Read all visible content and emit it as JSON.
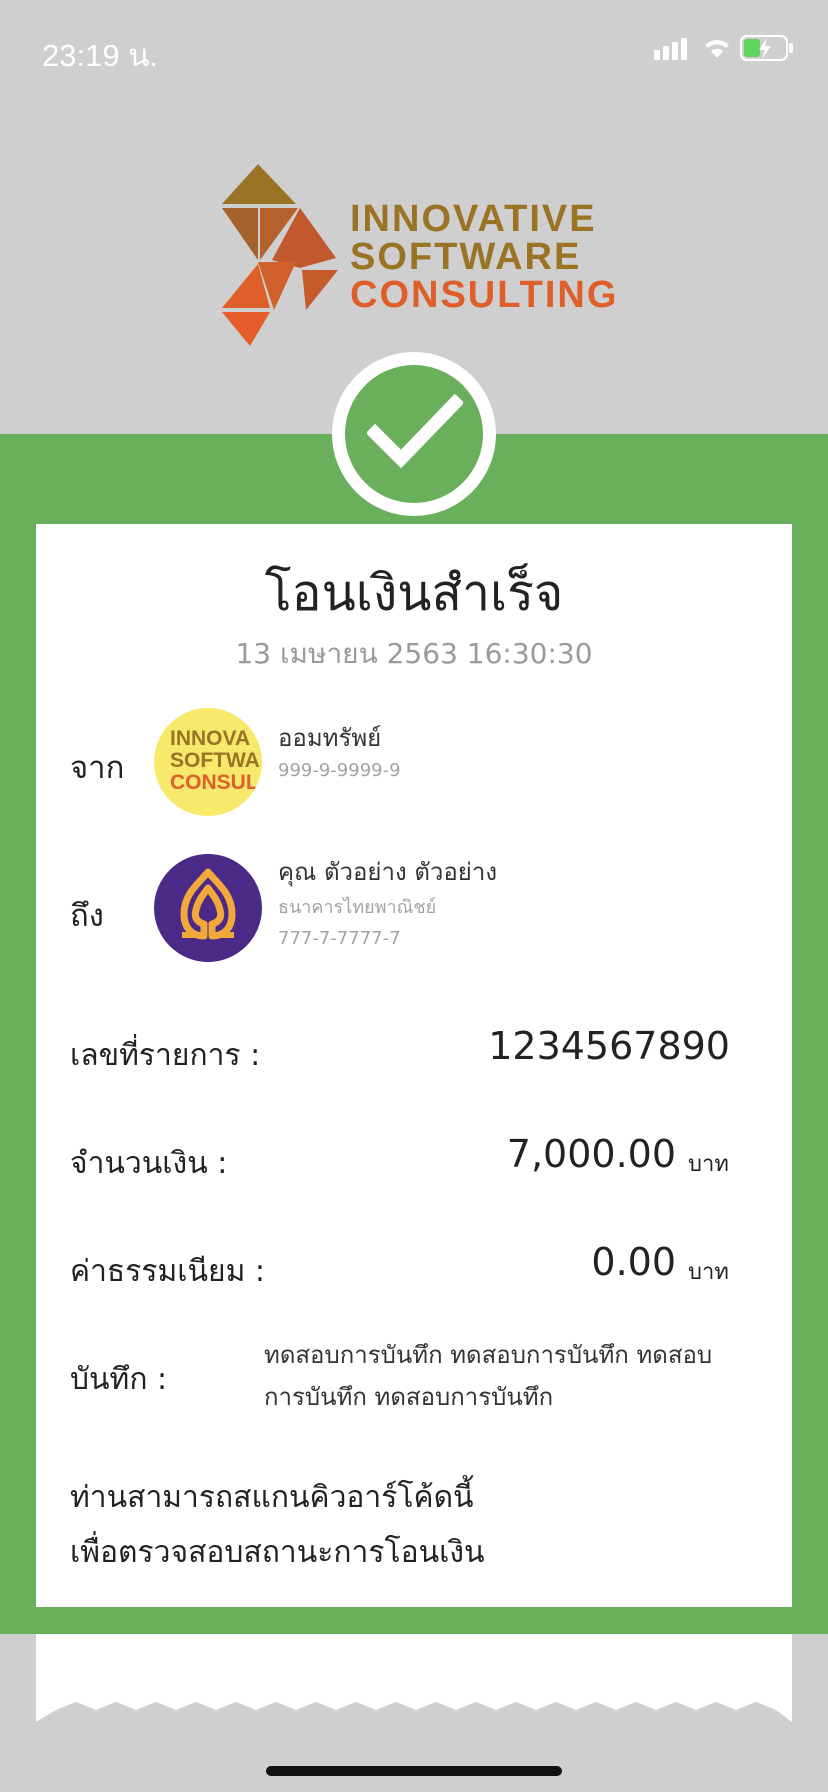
{
  "status_bar": {
    "time": "23:19 น."
  },
  "logo": {
    "line1": "INNOVATIVE",
    "line2": "SOFTWARE",
    "line3": "CONSULTING"
  },
  "receipt": {
    "title": "โอนเงินสำเร็จ",
    "datetime": "13 เมษายน 2563 16:30:30",
    "from": {
      "label": "จาก",
      "name": "ออมทรัพย์",
      "account": "999-9-9999-9",
      "avatar_text": [
        "INNOVA",
        "SOFTWA",
        "CONSUL"
      ]
    },
    "to": {
      "label": "ถึง",
      "name": "คุณ ตัวอย่าง ตัวอย่าง",
      "bank": "ธนาคารไทยพาณิชย์",
      "account": "777-7-7777-7"
    },
    "transaction_no": {
      "label": "เลขที่รายการ :",
      "value": "1234567890"
    },
    "amount": {
      "label": "จำนวนเงิน :",
      "value": "7,000.00",
      "unit": "บาท"
    },
    "fee": {
      "label": "ค่าธรรมเนียม :",
      "value": "0.00",
      "unit": "บาท"
    },
    "note": {
      "label": "บันทึก :",
      "value": "ทดสอบการบันทึก ทดสอบการบันทึก ทดสอบการบันทึก ทดสอบการบันทึก"
    },
    "qr_message": {
      "line1": "ท่านสามารถสแกนคิวอาร์โค้ดนี้",
      "line2": "เพื่อตรวจสอบสถานะการโอนเงิน"
    }
  },
  "colors": {
    "success_green": "#6aaf5c",
    "brand_gold": "#9a7424",
    "brand_orange": "#df5f2a",
    "scb_purple": "#4a2a86"
  }
}
